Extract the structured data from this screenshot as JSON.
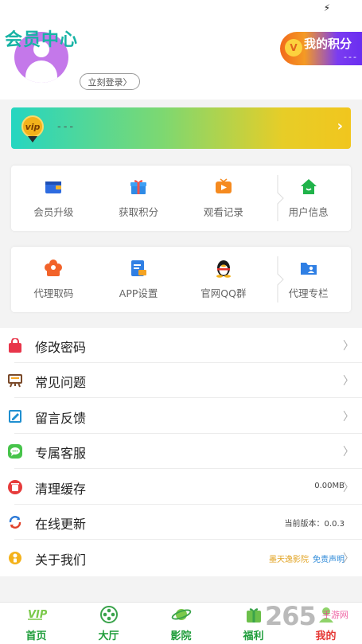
{
  "page": {
    "title": "会员中心"
  },
  "user": {
    "login_label": "立刻登录"
  },
  "points": {
    "label": "我的积分",
    "value": "---"
  },
  "vip": {
    "badge": "vip",
    "value": "---"
  },
  "grid_row1": [
    {
      "label": "会员升级",
      "icon": "wallet-icon"
    },
    {
      "label": "获取积分",
      "icon": "gift-icon"
    },
    {
      "label": "观看记录",
      "icon": "tv-icon"
    },
    {
      "label": "用户信息",
      "icon": "home-icon"
    }
  ],
  "grid_row2": [
    {
      "label": "代理取码",
      "icon": "flower-icon"
    },
    {
      "label": "APP设置",
      "icon": "document-icon"
    },
    {
      "label": "官网QQ群",
      "icon": "qq-penguin-icon"
    },
    {
      "label": "代理专栏",
      "icon": "folder-user-icon"
    }
  ],
  "menu": [
    {
      "label": "修改密码",
      "icon": "lock-bag-icon"
    },
    {
      "label": "常见问题",
      "icon": "easel-icon"
    },
    {
      "label": "留言反馈",
      "icon": "edit-icon"
    },
    {
      "label": "专属客服",
      "icon": "chat-icon"
    },
    {
      "label": "清理缓存",
      "icon": "trash-icon",
      "value": "0.00MB"
    },
    {
      "label": "在线更新",
      "icon": "refresh-icon",
      "value": "当前版本：0.0.3"
    },
    {
      "label": "关于我们",
      "icon": "info-icon",
      "brand": "墨天逸影院",
      "link": "免责声明"
    }
  ],
  "tabs": [
    {
      "label": "首页",
      "icon": "vip-home-icon"
    },
    {
      "label": "大厅",
      "icon": "film-reel-icon"
    },
    {
      "label": "影院",
      "icon": "planet-icon"
    },
    {
      "label": "福利",
      "icon": "gift-box-icon"
    },
    {
      "label": "我的",
      "icon": "user-icon",
      "active": true
    }
  ],
  "watermark": {
    "number": "265",
    "text": "手游网"
  },
  "colors": {
    "accent": "#17b3a5",
    "tab_green": "#1e9d3a",
    "tab_active": "#e53935"
  }
}
